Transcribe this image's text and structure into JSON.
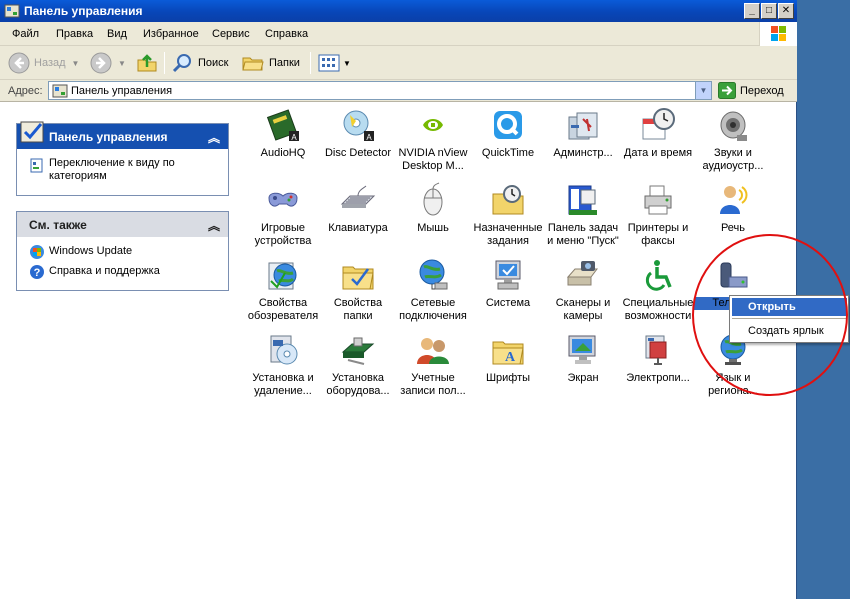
{
  "window": {
    "title": "Панель управления"
  },
  "menu": [
    "Файл",
    "Правка",
    "Вид",
    "Избранное",
    "Сервис",
    "Справка"
  ],
  "toolbar": {
    "back_label": "Назад",
    "search_label": "Поиск",
    "folders_label": "Папки"
  },
  "address": {
    "label": "Адрес:",
    "value": "Панель управления",
    "go_label": "Переход"
  },
  "taskpane": {
    "control_panel": {
      "title": "Панель управления",
      "link": "Переключение к виду по категориям"
    },
    "see_also": {
      "title": "См. также",
      "links": [
        "Windows Update",
        "Справка и поддержка"
      ]
    }
  },
  "items": [
    {
      "label": "AudioHQ",
      "icon": "audiohq-icon"
    },
    {
      "label": "Disc Detector",
      "icon": "disc-detector-icon"
    },
    {
      "label": "NVIDIA nView Desktop M...",
      "icon": "nvidia-icon"
    },
    {
      "label": "QuickTime",
      "icon": "quicktime-icon"
    },
    {
      "label": "Админстр...",
      "icon": "admin-tools-icon"
    },
    {
      "label": "Дата и время",
      "icon": "date-time-icon"
    },
    {
      "label": "Звуки и аудиоустр...",
      "icon": "sounds-icon"
    },
    {
      "label": "Игровые устройства",
      "icon": "game-controllers-icon"
    },
    {
      "label": "Клавиатура",
      "icon": "keyboard-icon"
    },
    {
      "label": "Мышь",
      "icon": "mouse-icon"
    },
    {
      "label": "Назначенные задания",
      "icon": "scheduled-tasks-icon"
    },
    {
      "label": "Панель задач и меню \"Пуск\"",
      "icon": "taskbar-icon"
    },
    {
      "label": "Принтеры и факсы",
      "icon": "printers-icon"
    },
    {
      "label": "Речь",
      "icon": "speech-icon"
    },
    {
      "label": "Свойства обозревателя",
      "icon": "internet-options-icon"
    },
    {
      "label": "Свойства папки",
      "icon": "folder-options-icon"
    },
    {
      "label": "Сетевые подключения",
      "icon": "network-icon"
    },
    {
      "label": "Система",
      "icon": "system-icon"
    },
    {
      "label": "Сканеры и камеры",
      "icon": "scanners-icon"
    },
    {
      "label": "Специальные возможности",
      "icon": "accessibility-icon"
    },
    {
      "label": "Теле мо",
      "icon": "phone-modem-icon"
    },
    {
      "label": "Установка и удаление...",
      "icon": "add-remove-icon"
    },
    {
      "label": "Установка оборудова...",
      "icon": "add-hardware-icon"
    },
    {
      "label": "Учетные записи пол...",
      "icon": "user-accounts-icon"
    },
    {
      "label": "Шрифты",
      "icon": "fonts-icon"
    },
    {
      "label": "Экран",
      "icon": "display-icon"
    },
    {
      "label": "Электропи...",
      "icon": "power-icon"
    },
    {
      "label": "Язык и региона...",
      "icon": "regional-icon"
    }
  ],
  "context_menu": {
    "open": "Открыть",
    "shortcut": "Создать ярлык"
  },
  "colors": {
    "titlebar": "#0a5bd8",
    "selection": "#316ac5",
    "annotation": "#e01010",
    "desktop": "#3a6ea5"
  }
}
